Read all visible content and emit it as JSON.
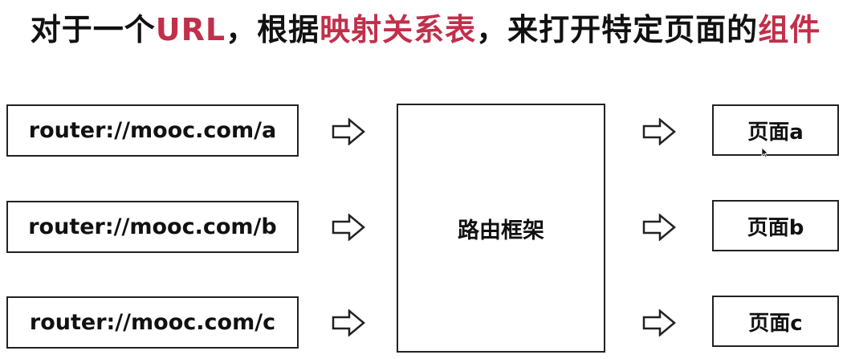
{
  "title": {
    "part1": "对于一个",
    "part2": "URL",
    "part3": "，根据",
    "part4": "映射关系表",
    "part5": "，来打开特定页面的",
    "part6": "组件"
  },
  "colors": {
    "highlight": "#c0304a",
    "stroke": "#222222"
  },
  "urls": [
    "router://mooc.com/a",
    "router://mooc.com/b",
    "router://mooc.com/c"
  ],
  "router_label": "路由框架",
  "pages": [
    "页面a",
    "页面b",
    "页面c"
  ],
  "icons": [
    "arrow-right-icon",
    "cursor-icon"
  ]
}
